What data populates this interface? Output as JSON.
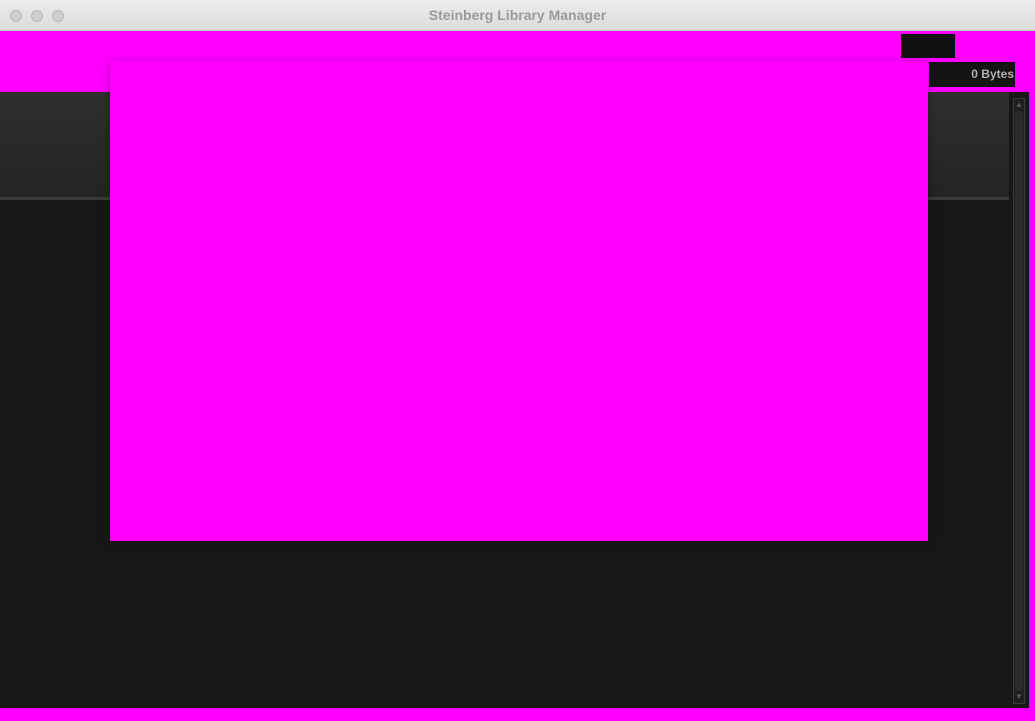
{
  "window": {
    "title": "Steinberg Library Manager"
  },
  "toolbar": {
    "size_label": "0 Bytes"
  },
  "colors": {
    "background": "#ff00ff",
    "panel": "#171717",
    "header": "#2a2a2a",
    "text": "#b0b0b0"
  },
  "icons": {
    "close": "close-icon",
    "minimize": "minimize-icon",
    "zoom": "zoom-icon",
    "scroll_up": "chevron-up-icon",
    "scroll_down": "chevron-down-icon"
  }
}
